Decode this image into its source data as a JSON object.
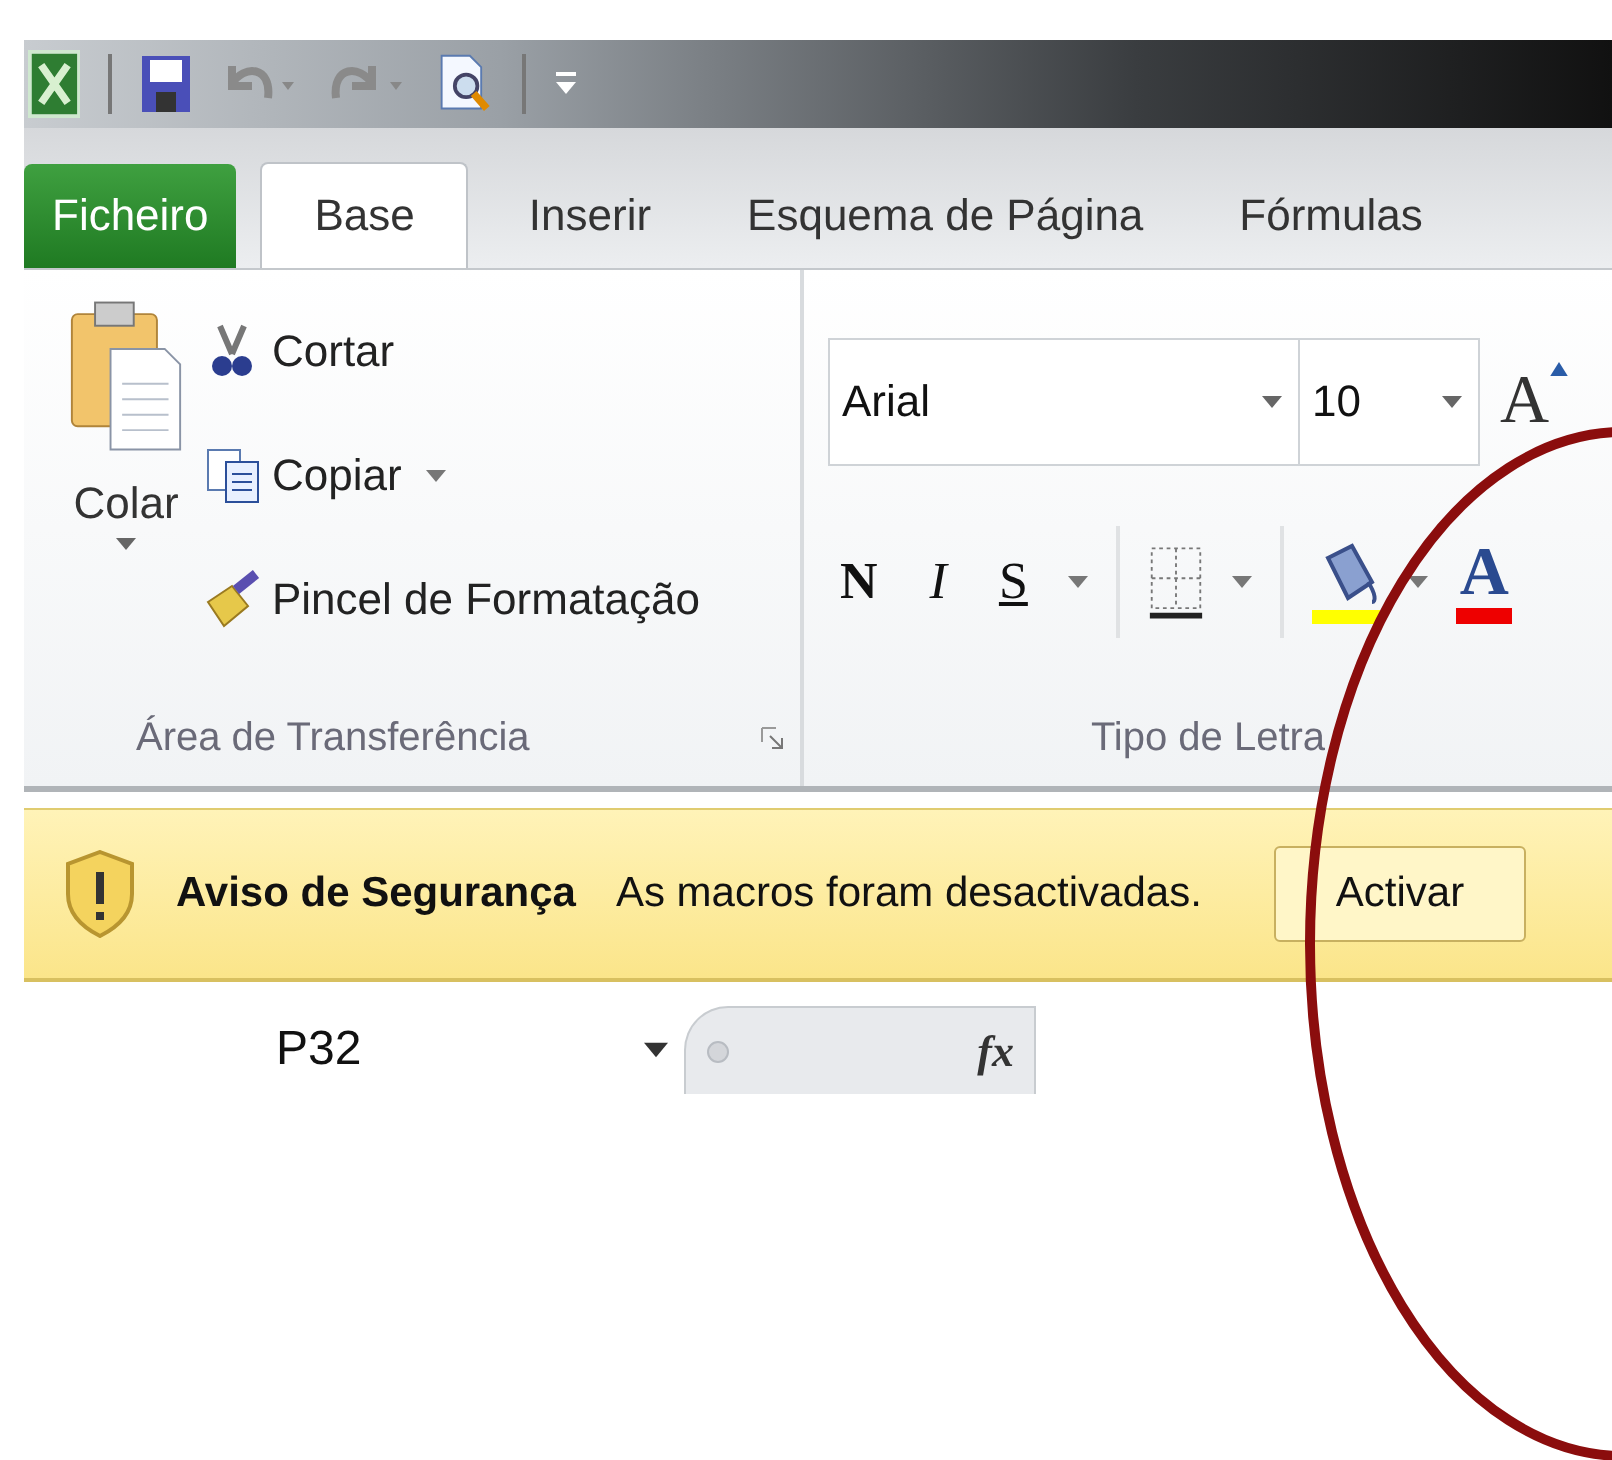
{
  "tabs": [
    {
      "label": "Ficheiro",
      "kind": "file",
      "selected": false
    },
    {
      "label": "Base",
      "kind": "tab",
      "selected": true
    },
    {
      "label": "Inserir",
      "kind": "tab",
      "selected": false
    },
    {
      "label": "Esquema de Página",
      "kind": "tab",
      "selected": false
    },
    {
      "label": "Fórmulas",
      "kind": "tab",
      "selected": false
    }
  ],
  "clipboard": {
    "paste_label": "Colar",
    "label": "Área de Transferência",
    "items": [
      {
        "kind": "cut",
        "label": "Cortar",
        "has_menu": false
      },
      {
        "kind": "copy",
        "label": "Copiar",
        "has_menu": true
      },
      {
        "kind": "painter",
        "label": "Pincel de Formatação",
        "has_menu": false
      }
    ]
  },
  "font": {
    "font_name": "Arial",
    "font_size": "10",
    "grow_label": "A",
    "bold_label": "N",
    "italic_label": "I",
    "underline_label": "S",
    "font_color_label": "A",
    "label": "Tipo de Letra"
  },
  "security_bar": {
    "title": "Aviso de Segurança",
    "message": "As macros foram desactivadas.",
    "button": "Activar"
  },
  "formula_bar": {
    "name_box": "P32",
    "function_label": "fx"
  }
}
